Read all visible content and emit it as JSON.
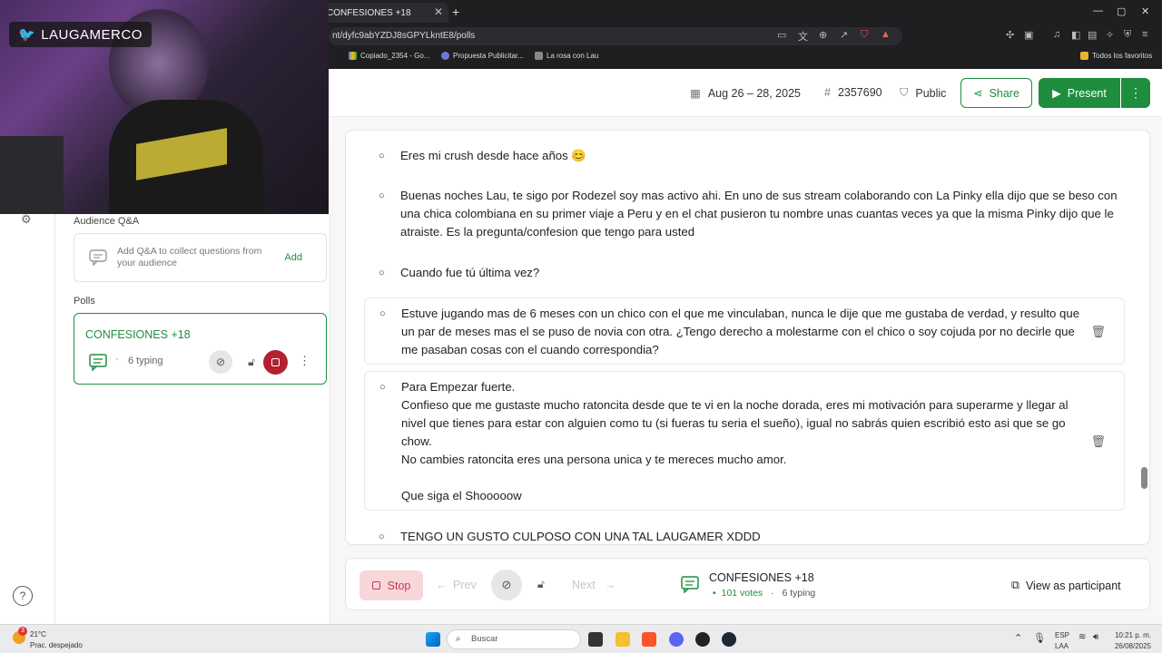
{
  "browser": {
    "tab_title": "CONFESIONES +18",
    "tab_close": "✕",
    "new_tab": "+",
    "url": "nt/dyfc9abYZDJ8sGPYLkntE8/polls",
    "win_min": "—",
    "win_max": "▢",
    "win_close": "✕",
    "bookmarks": [
      "Copiado_2354 - Go...",
      "Propuesta Publicitar...",
      "La rosa con Lau"
    ],
    "bookmarks_right": "Todos los favoritos"
  },
  "overlay": {
    "stream_name": "LAUGAMERCO"
  },
  "header": {
    "dates": "Aug 26 – 28, 2025",
    "event_code": "2357690",
    "visibility": "Public",
    "share_label": "Share",
    "present_label": "Present",
    "more": "⋮"
  },
  "sidebar": {
    "qa_label": "Audience Q&A",
    "qa_text": "Add Q&A to collect questions from your audience",
    "qa_add": "Add",
    "polls_label": "Polls",
    "poll_title": "CONFESIONES +18",
    "poll_typing": "6 typing",
    "poll_dot": "·"
  },
  "responses": [
    {
      "text": "Eres mi crush desde hace años 😊"
    },
    {
      "text": "Buenas noches Lau, te sigo por Rodezel soy mas activo ahi. En uno de sus stream colaborando con La Pinky ella dijo que se beso con una chica colombiana en su primer viaje a Peru y en el chat pusieron tu nombre unas cuantas veces ya que la misma Pinky dijo que le atraiste. Es la pregunta/confesion que tengo para usted"
    },
    {
      "text": "Cuando fue tú última vez?"
    },
    {
      "text": "Estuve jugando mas de 6 meses con un chico con el que me vinculaban, nunca le dije que me gustaba de verdad, y resulto que un par de meses mas el se puso de novia con otra. ¿Tengo derecho a molestarme con el chico o soy cojuda por no decirle que me pasaban cosas con el cuando correspondia?"
    },
    {
      "text": "Para Empezar fuerte.\nConfieso que me gustaste mucho ratoncita desde que te vi en la noche dorada, eres mi motivación para superarme y llegar al nivel que tienes para estar con alguien como tu (si fueras tu seria el sueño), igual no sabrás quien escribió esto asi que se go chow.\nNo cambies ratoncita eres una persona unica y te mereces mucho amor.\n\nQue siga el Shooooow"
    },
    {
      "text": "TENGO UN GUSTO CULPOSO CON UNA TAL LAUGAMER XDDD"
    }
  ],
  "controls": {
    "stop": "Stop",
    "prev": "Prev",
    "next": "Next",
    "poll_title": "CONFESIONES +18",
    "votes": "101 votes",
    "typing": "6 typing",
    "view_participant": "View as participant"
  },
  "taskbar": {
    "weather_temp": "21°C",
    "weather_desc": "Prac. despejado",
    "weather_badge": "3",
    "search_placeholder": "Buscar",
    "lang_top": "ESP",
    "lang_bottom": "LAA",
    "time": "10:21 p. m.",
    "date": "26/08/2025"
  },
  "colors": {
    "accent": "#1e8e3e",
    "stop_bg": "#f8d7da",
    "stop_text": "#c23b48",
    "record": "#b3202f"
  }
}
